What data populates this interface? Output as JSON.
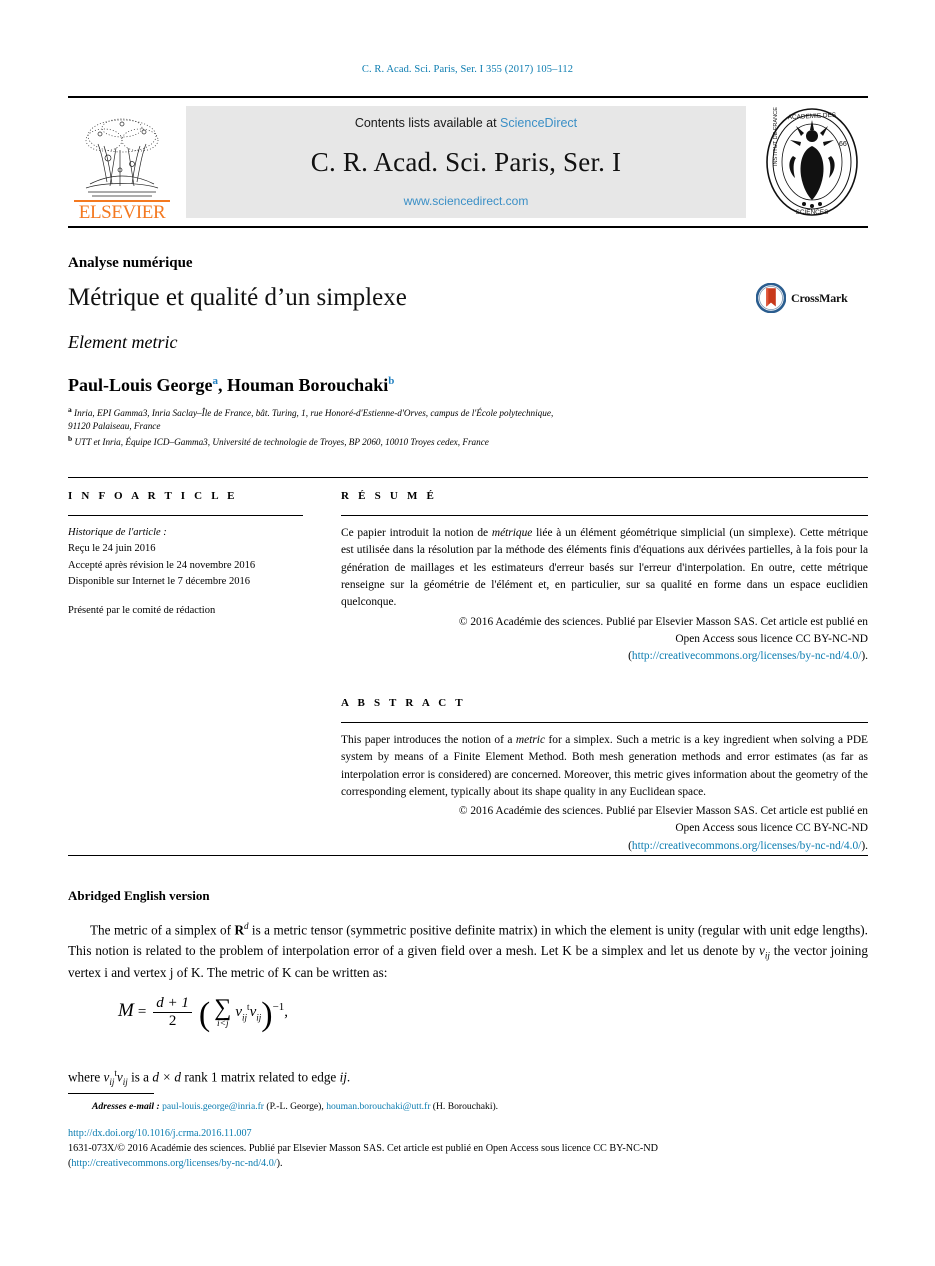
{
  "running_head": "C. R. Acad. Sci. Paris, Ser. I 355 (2017) 105–112",
  "masthead": {
    "publisher_name": "ELSEVIER",
    "contents_prefix": "Contents lists available at ",
    "contents_link": "ScienceDirect",
    "journal_title": "C. R. Acad. Sci. Paris, Ser. I",
    "journal_url": "www.sciencedirect.com"
  },
  "article": {
    "subject_area": "Analyse numérique",
    "title": "Métrique et qualité d’un simplexe",
    "subtitle": "Element metric",
    "authors_text": "Paul-Louis George",
    "author_a_marker": "a",
    "authors_text2": ", Houman Borouchaki",
    "author_b_marker": "b",
    "affiliation_a_marker": "a",
    "affiliation_a_line1": "Inria, EPI Gamma3, Inria Saclay–Île de France, bât. Turing, 1, rue Honoré-d'Estienne-d'Orves, campus de l'École polytechnique,",
    "affiliation_a_line2": "91120 Palaiseau, France",
    "affiliation_b_marker": "b",
    "affiliation_b_line1": "UTT et Inria, Équipe ICD–Gamma3, Université de technologie de Troyes, BP 2060, 10010 Troyes cedex, France",
    "crossmark_label": "CrossMark"
  },
  "info_section": {
    "heading": "I N F O   A R T I C L E",
    "history_label": "Historique de l'article :",
    "history_lines": [
      "Reçu le 24 juin 2016",
      "Accepté après révision le 24 novembre 2016",
      "Disponible sur Internet le 7 décembre 2016"
    ],
    "presented_by": "Présenté par le comité de rédaction"
  },
  "resume_section": {
    "heading": "R É S U M É",
    "text_part1": "Ce papier introduit la notion de ",
    "text_italic": "métrique",
    "text_part2": " liée à un élément géométrique simplicial (un simplexe). Cette métrique est utilisée dans la résolution par la méthode des éléments finis d'équations aux dérivées partielles, à la fois pour la génération de maillages et les estimateurs d'erreur basés sur l'erreur d'interpolation. En outre, cette métrique renseigne sur la géométrie de l'élément et, en particulier, sur sa qualité en forme dans un espace euclidien quelconque.",
    "copyright_line1": "© 2016 Académie des sciences. Publié par Elsevier Masson SAS. Cet article est publié en",
    "copyright_line2": "Open Access sous licence CC BY-NC-ND",
    "license_open": "(",
    "license_url": "http://creativecommons.org/licenses/by-nc-nd/4.0/",
    "license_close": ")."
  },
  "abstract_section": {
    "heading": "A B S T R A C T",
    "text_part1": "This paper introduces the notion of a ",
    "text_italic": "metric",
    "text_part2": " for a simplex. Such a metric is a key ingredient when solving a PDE system by means of a Finite Element Method. Both mesh generation methods and error estimates (as far as interpolation error is considered) are concerned. Moreover, this metric gives information about the geometry of the corresponding element, typically about its shape quality in any Euclidean space.",
    "copyright_line1": "© 2016 Académie des sciences. Publié par Elsevier Masson SAS. Cet article est publié en",
    "copyright_line2": "Open Access sous licence CC BY-NC-ND",
    "license_open": "(",
    "license_url": "http://creativecommons.org/licenses/by-nc-nd/4.0/",
    "license_close": ")."
  },
  "body": {
    "section_heading": "Abridged English version",
    "paragraph_p1": "The metric of a simplex of ",
    "paragraph_rd": "R",
    "paragraph_rd_exp": "d",
    "paragraph_p2": " is a metric tensor (symmetric positive definite matrix) in which the element is unity (regular with unit edge lengths). This notion is related to the problem of interpolation error of a given field over a mesh. Let K be a simplex and let us denote by ",
    "paragraph_v": "v",
    "paragraph_v_sub": "ij",
    "paragraph_p3": " the vector joining vertex i and vertex j of K. The metric of K can be written as:",
    "formula": {
      "lhs": "M",
      "equals": "=",
      "frac_num": "d + 1",
      "frac_den": "2",
      "sum_symbol": "∑",
      "sum_limit": "i<j",
      "term_v1": "v",
      "term_v1_sub": "ij",
      "term_t": "t",
      "term_v2": "v",
      "term_v2_sub": "ij",
      "exponent": "−1",
      "trailing": ","
    },
    "after_formula_p1": "where ",
    "after_formula_v1": "v",
    "after_formula_v1_sub": "ij",
    "after_formula_t": "t",
    "after_formula_v2": "v",
    "after_formula_v2_sub": "ij",
    "after_formula_p2": " is a ",
    "after_formula_dxd": "d × d",
    "after_formula_p3": " rank 1 matrix related to edge ",
    "after_formula_ij": "ij",
    "after_formula_p4": "."
  },
  "footer": {
    "email_label": "Adresses e-mail :",
    "email_1": "paul-louis.george@inria.fr",
    "email_1_owner": " (P.-L. George),",
    "email_2": "houman.borouchaki@utt.fr",
    "email_2_owner": " (H. Borouchaki).",
    "doi_url": "http://dx.doi.org/10.1016/j.crma.2016.11.007",
    "legal_line": "1631-073X/© 2016 Académie des sciences. Publié par Elsevier Masson SAS. Cet article est publié en Open Access sous licence CC BY-NC-ND",
    "license_open": "(",
    "license_url": "http://creativecommons.org/licenses/by-nc-nd/4.0/",
    "license_close": ")."
  },
  "colors": {
    "link": "#0b7cb0",
    "sciencedirect": "#3a8fc6",
    "elsevier_orange": "#F47920",
    "marker": "#1f7fc0",
    "band_bg": "#e7e7e7",
    "crossmark_red": "#c8391b",
    "crossmark_blue": "#2a5d8f"
  }
}
